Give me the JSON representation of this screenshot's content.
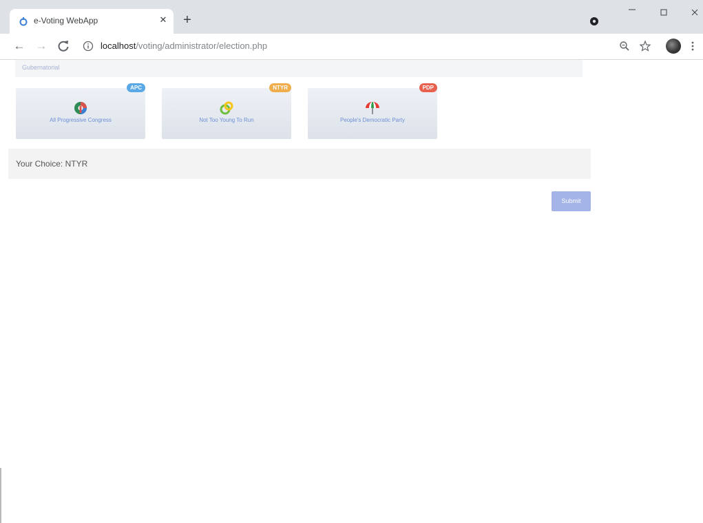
{
  "browser": {
    "tab_title": "e-Voting WebApp",
    "url_host": "localhost",
    "url_path": "/voting/administrator/election.php"
  },
  "page": {
    "section_label": "Gubernatorial",
    "parties": [
      {
        "badge": "APC",
        "name": "All Progressive Congress",
        "badge_color": "#5aa9e6"
      },
      {
        "badge": "NTYR",
        "name": "Not Too Young To Run",
        "badge_color": "#f0ad4e"
      },
      {
        "badge": "PDP",
        "name": "People's Democratic Party",
        "badge_color": "#e8614f"
      }
    ],
    "choice_text": "Your Choice: NTYR",
    "submit_label": "Submit"
  },
  "colors": {
    "accent": "#a4b4e8",
    "card_text": "#6d8fd6",
    "chrome": "#dee1e6"
  },
  "icons": [
    "favicon-icon",
    "close-icon",
    "plus-icon",
    "extension-icon",
    "minimize-icon",
    "maximize-icon",
    "window-close-icon",
    "back-icon",
    "forward-icon",
    "reload-icon",
    "info-icon",
    "zoom-icon",
    "star-icon",
    "menu-icon",
    "apc-logo-icon",
    "ntyr-logo-icon",
    "pdp-umbrella-icon"
  ]
}
